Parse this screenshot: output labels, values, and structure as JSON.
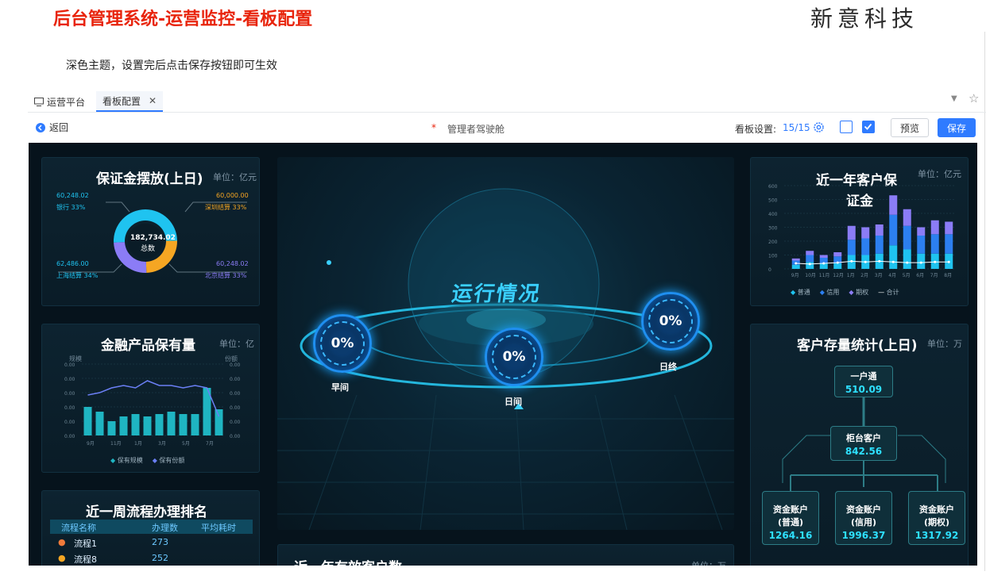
{
  "doc": {
    "title": "后台管理系统-运营监控-看板配置",
    "brand": "新意科技",
    "description": "深色主题，设置完后点击保存按钮即可生效"
  },
  "tabs": [
    {
      "label": "运营平台",
      "icon": "monitor-icon"
    },
    {
      "label": "看板配置",
      "icon": "close-icon"
    }
  ],
  "toolbar": {
    "back": "返回",
    "required_mark": "*",
    "name": "管理者驾驶舱",
    "settings_label": "看板设置:",
    "settings_value": "15/15",
    "preview": "预览",
    "save": "保存"
  },
  "panels": {
    "deposit": {
      "title": "保证金摆放(上日)",
      "unit": "单位：亿元",
      "total": "182,734.02",
      "total_label": "总数",
      "items": [
        {
          "value": "60,248.02",
          "label": "银行 33%",
          "color": "#1fc3f0"
        },
        {
          "value": "60,000.00",
          "label": "深圳结算 33%",
          "color": "#f5a623"
        },
        {
          "value": "62,486.00",
          "label": "上海结算 34%",
          "color": "#1fc3f0"
        },
        {
          "value": "60,248.02",
          "label": "北京结算 33%",
          "color": "#8b7cf6"
        }
      ],
      "donut": [
        {
          "name": "银行",
          "value": 60248.02,
          "color": "#1fc3f0"
        },
        {
          "name": "深圳结算",
          "value": 60000,
          "color": "#f5a623"
        },
        {
          "name": "北京结算",
          "value": 60248.02,
          "color": "#8b7cf6"
        },
        {
          "name": "上海结算",
          "value": 62486,
          "color": "#1fc3f0"
        }
      ]
    },
    "finance": {
      "title": "金融产品保有量",
      "unit": "单位：亿",
      "left_axis": "规模",
      "right_axis": "份额",
      "yticks": [
        "0.00",
        "0.00",
        "0.00",
        "0.00",
        "0.00",
        "0.00"
      ],
      "xticks": [
        "9月",
        "11月",
        "1月",
        "3月",
        "5月",
        "7月"
      ],
      "legend": [
        {
          "label": "保有规模",
          "color": "#1fb5c2"
        },
        {
          "label": "保有份额",
          "color": "#6b7ff5"
        }
      ]
    },
    "customer_year": {
      "title_line1": "近一年客户保",
      "title_line2": "证金",
      "unit": "单位：亿元",
      "yticks": [
        "600",
        "500",
        "400",
        "300",
        "200",
        "100",
        "0"
      ],
      "xticks": [
        "9月",
        "10月",
        "11月",
        "12月",
        "1月",
        "2月",
        "3月",
        "4月",
        "5月",
        "6月",
        "7月",
        "8月"
      ],
      "legend": [
        {
          "label": "普通",
          "color": "#1fc3f0"
        },
        {
          "label": "信用",
          "color": "#2c7ff0"
        },
        {
          "label": "期权",
          "color": "#8b7cf6"
        },
        {
          "label": "合计",
          "color": "#ffffff"
        }
      ]
    },
    "running": {
      "title": "运行情况",
      "rings": [
        {
          "value": "0%",
          "label": "早间"
        },
        {
          "value": "0%",
          "label": "日间"
        },
        {
          "value": "0%",
          "label": "日终"
        }
      ]
    },
    "stock": {
      "title": "客户存量统计(上日)",
      "unit": "单位：万",
      "top": {
        "label": "一户通",
        "value": "510.09"
      },
      "mid": {
        "label": "柜台客户",
        "value": "842.56"
      },
      "leaves": [
        {
          "label1": "资金账户",
          "label2": "(普通)",
          "value": "1264.16"
        },
        {
          "label1": "资金账户",
          "label2": "(信用)",
          "value": "1996.37"
        },
        {
          "label1": "资金账户",
          "label2": "(期权)",
          "value": "1317.92"
        }
      ]
    },
    "ranking": {
      "title": "近一周流程办理排名",
      "headers": [
        "流程名称",
        "办理数",
        "平均耗时"
      ],
      "rows": [
        {
          "name": "流程1",
          "count": "273"
        },
        {
          "name": "流程8",
          "count": "252"
        }
      ]
    },
    "effective": {
      "title": "近一年有效客户数",
      "unit": "单位：万"
    }
  },
  "chart_data": [
    {
      "type": "bar",
      "title": "近一年客户保证金",
      "categories": [
        "9月",
        "10月",
        "11月",
        "12月",
        "1月",
        "2月",
        "3月",
        "4月",
        "5月",
        "6月",
        "7月",
        "8月"
      ],
      "ylim": [
        0,
        600
      ],
      "series": [
        {
          "name": "普通",
          "values": [
            30,
            50,
            40,
            40,
            100,
            100,
            110,
            170,
            140,
            110,
            110,
            110
          ]
        },
        {
          "name": "信用",
          "values": [
            30,
            50,
            40,
            50,
            110,
            120,
            130,
            220,
            170,
            130,
            140,
            140
          ]
        },
        {
          "name": "期权",
          "values": [
            15,
            30,
            20,
            30,
            100,
            80,
            80,
            140,
            120,
            60,
            100,
            90
          ]
        },
        {
          "name": "合计",
          "values": [
            40,
            35,
            40,
            45,
            55,
            50,
            55,
            50,
            45,
            45,
            50,
            50
          ]
        }
      ]
    },
    {
      "type": "bar",
      "title": "金融产品保有量",
      "categories": [
        "9月",
        "10月",
        "11月",
        "12月",
        "1月",
        "2月",
        "3月",
        "4月",
        "5月",
        "6月",
        "7月",
        "8月"
      ],
      "series": [
        {
          "name": "保有规模",
          "values": [
            0.6,
            0.5,
            0.3,
            0.4,
            0.45,
            0.4,
            0.45,
            0.5,
            0.45,
            0.45,
            1.0,
            0.55
          ]
        },
        {
          "name": "保有份额",
          "values": [
            0.85,
            0.9,
            1.0,
            1.05,
            1.0,
            1.15,
            1.05,
            1.05,
            1.0,
            1.05,
            1.0,
            0.4
          ]
        }
      ]
    }
  ]
}
